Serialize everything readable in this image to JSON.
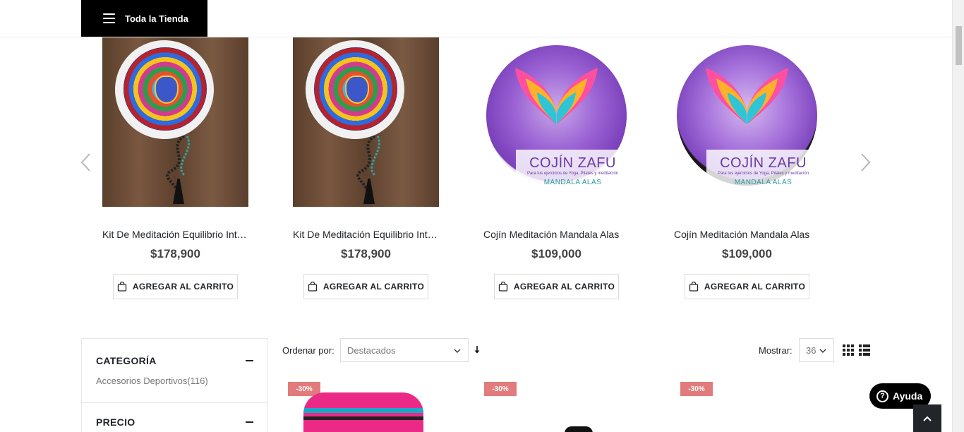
{
  "header": {
    "store_button_label": "Toda la Tienda"
  },
  "carousel": {
    "products": [
      {
        "name": "Kit De Meditación Equilibrio Interior",
        "price": "$178,900",
        "image": "kit-meditacion"
      },
      {
        "name": "Kit De Meditación Equilibrio Interior",
        "price": "$178,900",
        "image": "kit-meditacion"
      },
      {
        "name": "Cojín Meditación Mandala Alas",
        "price": "$109,000",
        "image": "cojin-zafu-blanco"
      },
      {
        "name": "Cojín Meditación Mandala Alas",
        "price": "$109,000",
        "image": "cojin-zafu-negro"
      }
    ],
    "add_to_cart_label": "AGREGAR AL CARRITO",
    "zafu_label": {
      "title": "COJÍN ZAFU",
      "subtitle": "Para tus ejercicios de Yoga, Pilates y meditación",
      "design": "MANDALA ALAS"
    }
  },
  "sidebar": {
    "category_title": "CATEGORÍA",
    "category_item": "Accesorios Deportivos",
    "category_count": "(116)",
    "price_title": "PRECIO"
  },
  "toolbar": {
    "sort_label": "Ordenar por:",
    "sort_value": "Destacados",
    "show_label": "Mostrar:",
    "show_value": "36"
  },
  "listing": {
    "badges": [
      "-30%",
      "-30%",
      "-30%"
    ]
  },
  "help": {
    "label": "Ayuda"
  },
  "colors": {
    "badge": "#e27c7c",
    "dark": "#222529",
    "black": "#000000"
  },
  "icons": [
    "hamburger-icon",
    "chevron-left-icon",
    "chevron-right-icon",
    "shopping-bag-icon",
    "minus-icon",
    "chevron-down-icon",
    "sort-down-arrow-icon",
    "grid-view-icon",
    "list-view-icon",
    "help-circle-icon",
    "chevron-up-icon"
  ]
}
